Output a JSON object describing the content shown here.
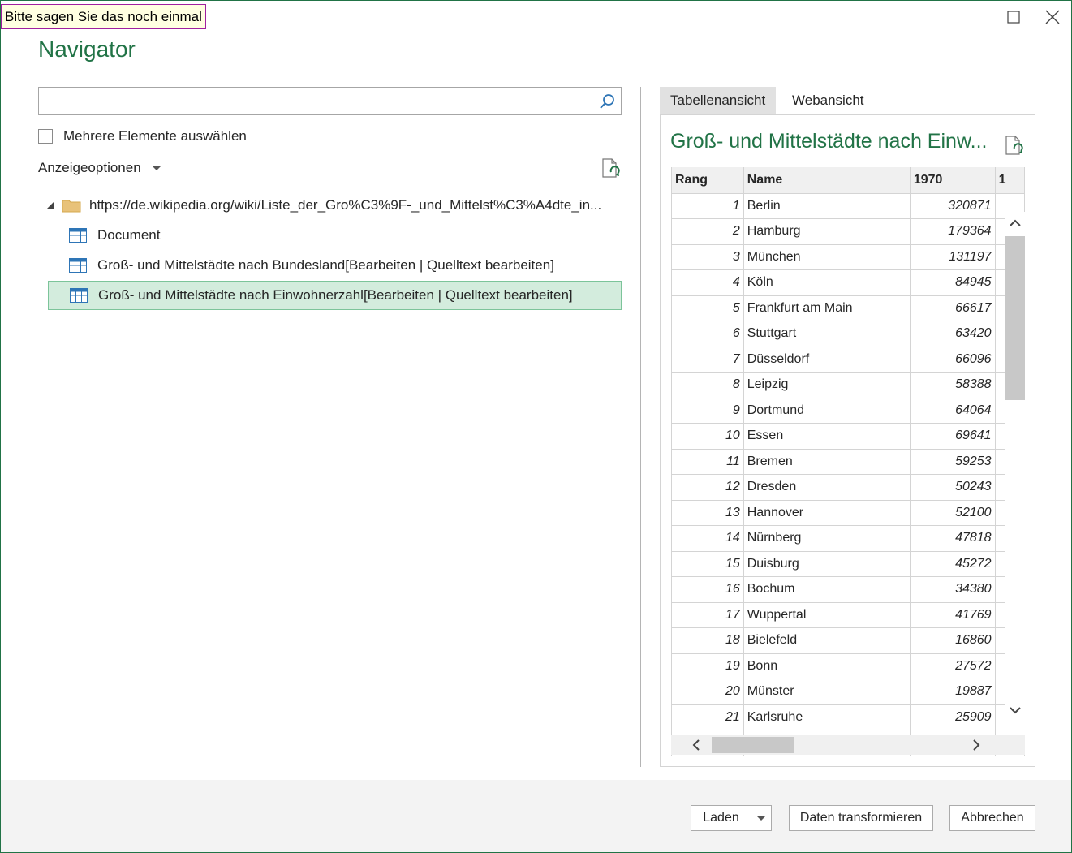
{
  "tooltip": "Bitte sagen Sie das noch einmal",
  "title": "Navigator",
  "search": {
    "value": "",
    "placeholder": ""
  },
  "multi_select_label": "Mehrere Elemente auswählen",
  "display_options_label": "Anzeigeoptionen",
  "tree": {
    "root_label": "https://de.wikipedia.org/wiki/Liste_der_Gro%C3%9F-_und_Mittelst%C3%A4dte_in...",
    "items": [
      {
        "label": "Document"
      },
      {
        "label": "Groß- und Mittelstädte nach Bundesland[Bearbeiten | Quelltext bearbeiten]"
      },
      {
        "label": "Groß- und Mittelstädte nach Einwohnerzahl[Bearbeiten | Quelltext bearbeiten]"
      }
    ]
  },
  "tabs": {
    "table_view": "Tabellenansicht",
    "web_view": "Webansicht"
  },
  "preview": {
    "title": "Groß- und Mittelstädte nach Einw...",
    "columns": [
      "Rang",
      "Name",
      "1970",
      "1"
    ],
    "rows": [
      {
        "rank": "1",
        "name": "Berlin",
        "v1970": "320871"
      },
      {
        "rank": "2",
        "name": "Hamburg",
        "v1970": "179364"
      },
      {
        "rank": "3",
        "name": "München",
        "v1970": "131197"
      },
      {
        "rank": "4",
        "name": "Köln",
        "v1970": "84945"
      },
      {
        "rank": "5",
        "name": "Frankfurt am Main",
        "v1970": "66617"
      },
      {
        "rank": "6",
        "name": "Stuttgart",
        "v1970": "63420"
      },
      {
        "rank": "7",
        "name": "Düsseldorf",
        "v1970": "66096"
      },
      {
        "rank": "8",
        "name": "Leipzig",
        "v1970": "58388"
      },
      {
        "rank": "9",
        "name": "Dortmund",
        "v1970": "64064"
      },
      {
        "rank": "10",
        "name": "Essen",
        "v1970": "69641"
      },
      {
        "rank": "11",
        "name": "Bremen",
        "v1970": "59253"
      },
      {
        "rank": "12",
        "name": "Dresden",
        "v1970": "50243"
      },
      {
        "rank": "13",
        "name": "Hannover",
        "v1970": "52100"
      },
      {
        "rank": "14",
        "name": "Nürnberg",
        "v1970": "47818"
      },
      {
        "rank": "15",
        "name": "Duisburg",
        "v1970": "45272"
      },
      {
        "rank": "16",
        "name": "Bochum",
        "v1970": "34380"
      },
      {
        "rank": "17",
        "name": "Wuppertal",
        "v1970": "41769"
      },
      {
        "rank": "18",
        "name": "Bielefeld",
        "v1970": "16860"
      },
      {
        "rank": "19",
        "name": "Bonn",
        "v1970": "27572"
      },
      {
        "rank": "20",
        "name": "Münster",
        "v1970": "19887"
      },
      {
        "rank": "21",
        "name": "Karlsruhe",
        "v1970": "25909"
      },
      {
        "rank": "",
        "name": "",
        "v1970": ""
      }
    ]
  },
  "buttons": {
    "load": "Laden",
    "transform": "Daten transformieren",
    "cancel": "Abbrechen"
  },
  "colors": {
    "accent": "#217346",
    "selected_bg": "#d3ecdd",
    "selected_border": "#7cc49a"
  }
}
